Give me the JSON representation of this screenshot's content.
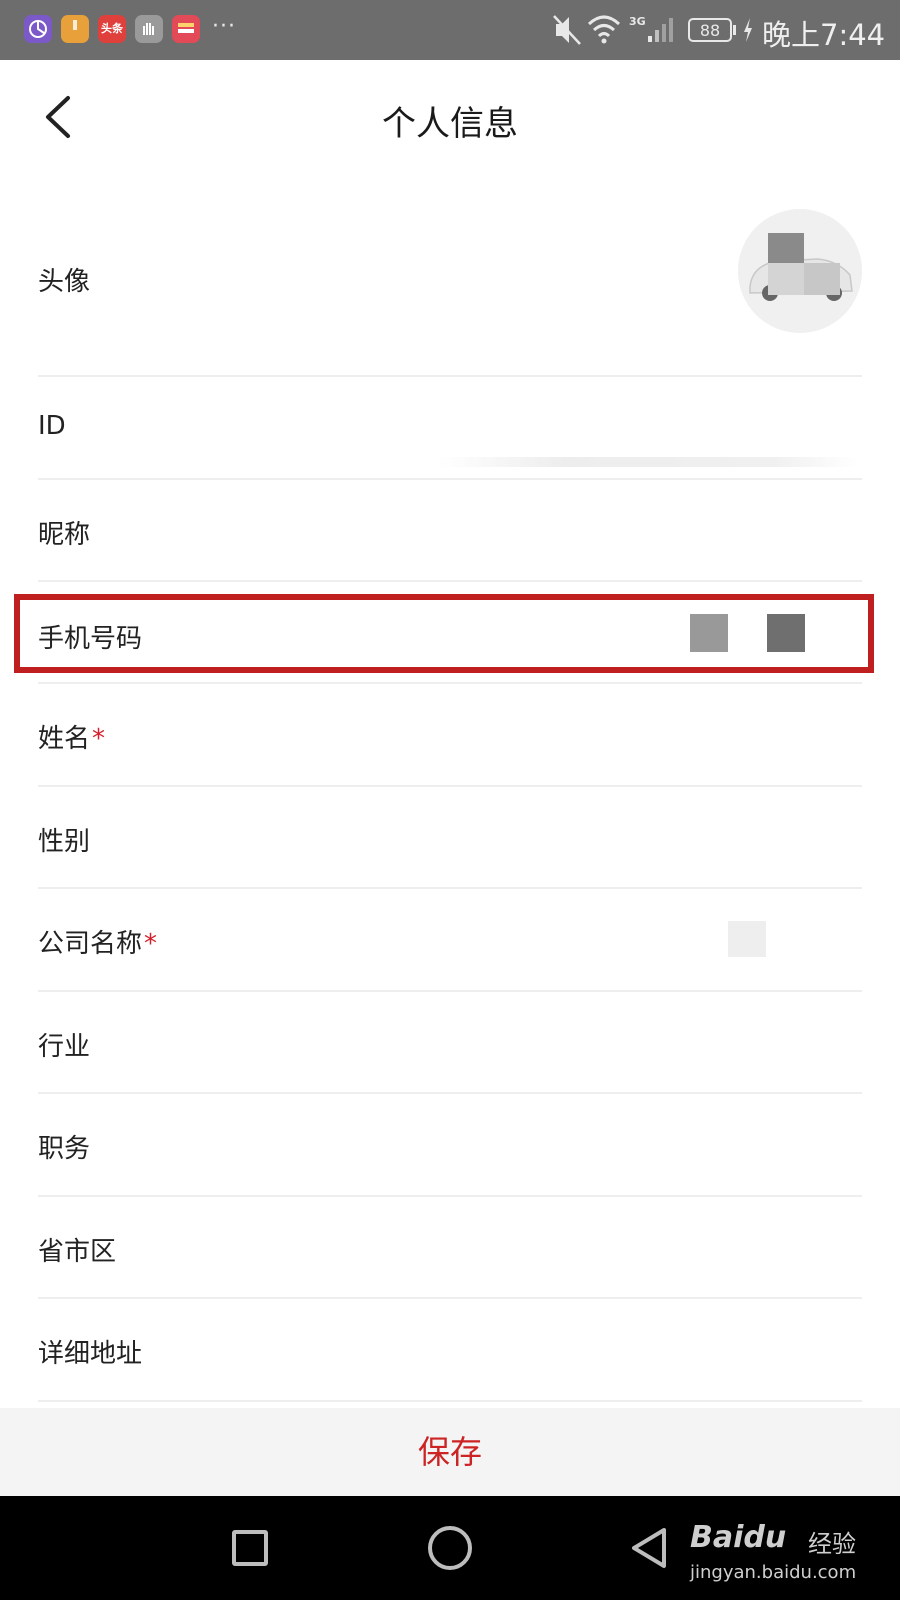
{
  "status_bar": {
    "apps": [
      {
        "name": "Planet app",
        "color": "#7b59c8",
        "text": ""
      },
      {
        "name": "Package app",
        "color": "#e8a03b",
        "text": ""
      },
      {
        "name": "头条",
        "color": "#e0403c",
        "text": "头条"
      },
      {
        "name": "Hand app",
        "color": "#9a9a9a",
        "text": ""
      },
      {
        "name": "Card app",
        "color": "#e24a57",
        "text": ""
      }
    ],
    "more": "···",
    "network": "3G",
    "battery": "88",
    "time": "晚上7:44"
  },
  "header": {
    "title": "个人信息"
  },
  "rows": [
    {
      "label": "头像",
      "required": false,
      "key": "avatar"
    },
    {
      "label": "ID",
      "required": false,
      "key": "id"
    },
    {
      "label": "昵称",
      "required": false,
      "key": "nickname"
    },
    {
      "label": "手机号码",
      "required": false,
      "key": "phone"
    },
    {
      "label": "姓名",
      "required": true,
      "key": "name"
    },
    {
      "label": "性别",
      "required": false,
      "key": "gender"
    },
    {
      "label": "公司名称",
      "required": true,
      "key": "company"
    },
    {
      "label": "行业",
      "required": false,
      "key": "industry"
    },
    {
      "label": "职务",
      "required": false,
      "key": "position"
    },
    {
      "label": "省市区",
      "required": false,
      "key": "region"
    },
    {
      "label": "详细地址",
      "required": false,
      "key": "address"
    }
  ],
  "required_mark": "*",
  "save_button": "保存",
  "watermark": {
    "brand": "Baidu",
    "suffix": "经验",
    "url": "jingyan.baidu.com"
  },
  "colors": {
    "highlight": "#c01f1f",
    "accent": "#cc2424",
    "status_bar": "#6d6d6d"
  }
}
